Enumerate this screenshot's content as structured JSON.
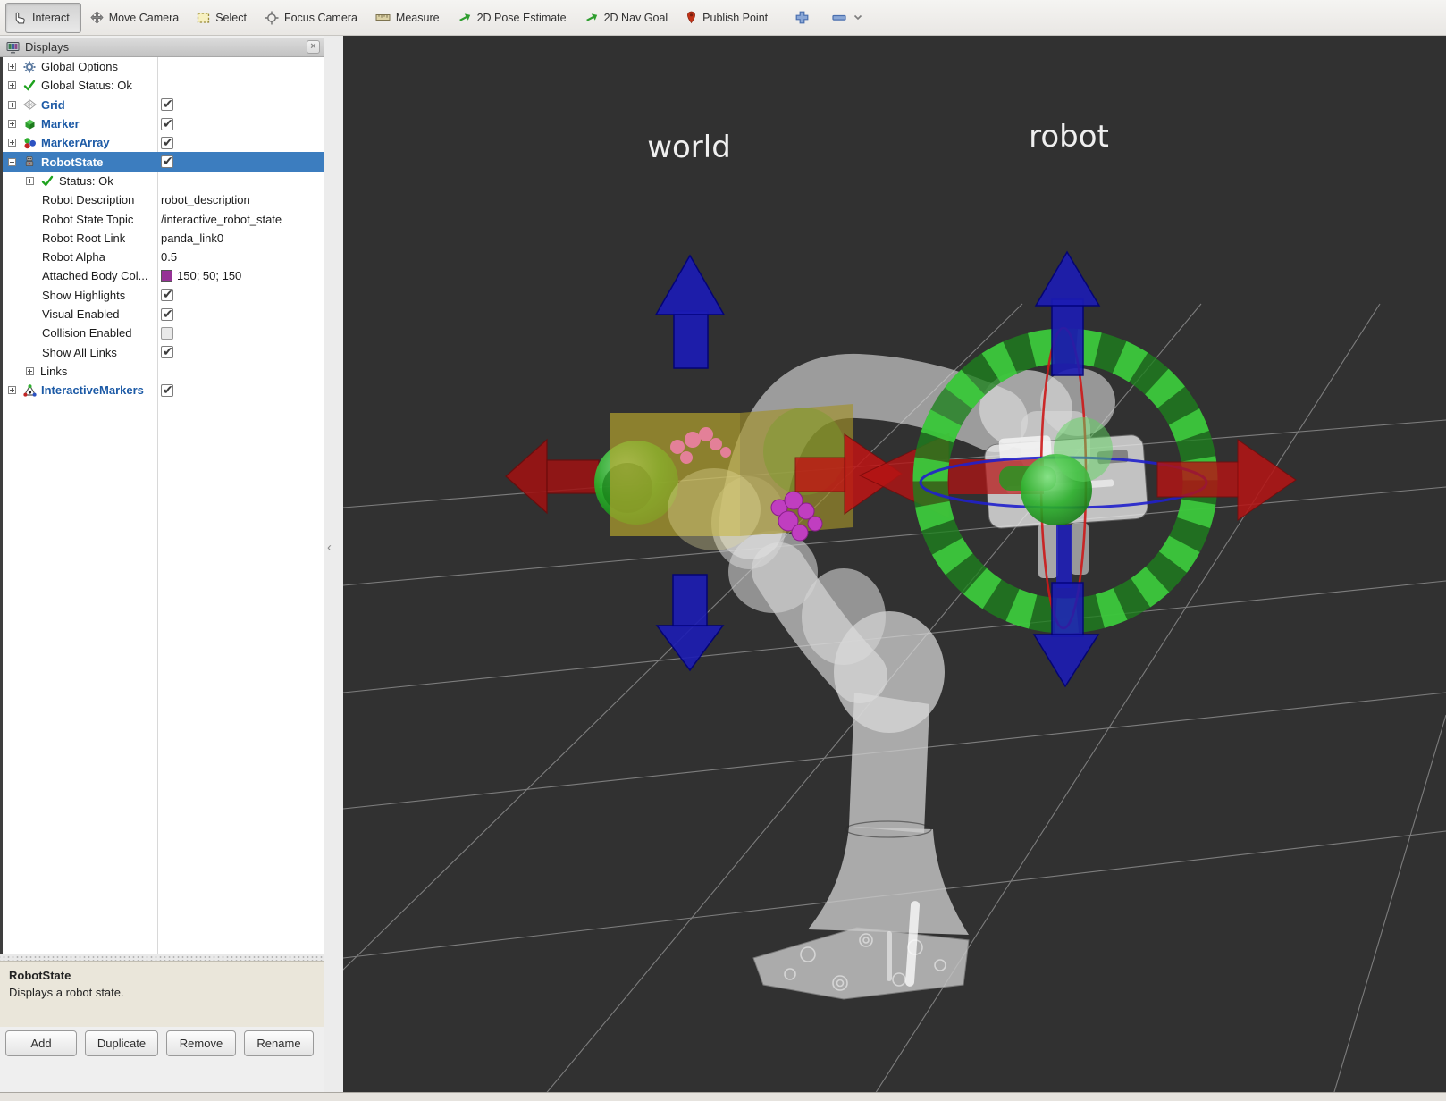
{
  "toolbar": {
    "tools": [
      {
        "label": "Interact",
        "icon": "hand-icon",
        "active": true
      },
      {
        "label": "Move Camera",
        "icon": "move-camera-icon",
        "active": false
      },
      {
        "label": "Select",
        "icon": "select-box-icon",
        "active": false
      },
      {
        "label": "Focus Camera",
        "icon": "focus-camera-icon",
        "active": false
      },
      {
        "label": "Measure",
        "icon": "measure-ruler-icon",
        "active": false
      },
      {
        "label": "2D Pose Estimate",
        "icon": "green-arrow-icon",
        "active": false
      },
      {
        "label": "2D Nav Goal",
        "icon": "green-arrow-icon",
        "active": false
      },
      {
        "label": "Publish Point",
        "icon": "map-pin-icon",
        "active": false
      }
    ],
    "add_tool_icon": "plus-icon",
    "remove_tool_icon": "minus-icon"
  },
  "displays_panel": {
    "title": "Displays",
    "close_icon": "×",
    "rows": [
      {
        "label": "Global Options",
        "icon": "gear-icon",
        "expander": "plus"
      },
      {
        "label": "Global Status: Ok",
        "icon": "check-icon",
        "expander": "plus"
      },
      {
        "label": "Grid",
        "icon": "grid-icon",
        "expander": "plus",
        "checkbox": "checked",
        "bold": true
      },
      {
        "label": "Marker",
        "icon": "marker-cube-icon",
        "expander": "plus",
        "checkbox": "checked",
        "bold": true
      },
      {
        "label": "MarkerArray",
        "icon": "marker-array-icon",
        "expander": "plus",
        "checkbox": "checked",
        "bold": true
      },
      {
        "label": "RobotState",
        "icon": "robot-icon",
        "expander": "minus",
        "checkbox": "checked",
        "bold": true,
        "selected": true
      },
      {
        "label": "Status: Ok",
        "icon": "check-icon",
        "expander": "plus",
        "indent": 1
      },
      {
        "label": "Robot Description",
        "value": "robot_description",
        "indent": 1
      },
      {
        "label": "Robot State Topic",
        "value": "/interactive_robot_state",
        "indent": 1
      },
      {
        "label": "Robot Root Link",
        "value": "panda_link0",
        "indent": 1
      },
      {
        "label": "Robot Alpha",
        "value": "0.5",
        "indent": 1
      },
      {
        "label": "Attached Body Col...",
        "value": "150; 50; 150",
        "swatch": "#963296",
        "indent": 1
      },
      {
        "label": "Show Highlights",
        "checkbox": "checked",
        "indent": 1
      },
      {
        "label": "Visual Enabled",
        "checkbox": "checked",
        "indent": 1
      },
      {
        "label": "Collision Enabled",
        "checkbox": "unchecked",
        "indent": 1
      },
      {
        "label": "Show All Links",
        "checkbox": "checked",
        "indent": 1
      },
      {
        "label": "Links",
        "expander": "plus",
        "indent": 1
      },
      {
        "label": "InteractiveMarkers",
        "icon": "interactive-markers-icon",
        "expander": "plus",
        "checkbox": "checked",
        "bold": true
      }
    ],
    "description": {
      "title": "RobotState",
      "text": "Displays a robot state."
    },
    "buttons": [
      "Add",
      "Duplicate",
      "Remove",
      "Rename"
    ]
  },
  "viewport": {
    "frame_labels": [
      {
        "text": "world"
      },
      {
        "text": "robot"
      }
    ],
    "colors": {
      "background": "#313131",
      "grid_line": "#c8c8c8",
      "attached_cube_yellow": "#b8a62e",
      "arrow_red": "#b51414",
      "arrow_blue": "#1c1cb4",
      "ring_green_light": "#3fd03f",
      "ring_green_dark": "#1d821d",
      "sphere_green": "#2ab02a",
      "contact_pink": "#e8809e",
      "contact_magenta": "#c03ec0",
      "robot_gray": "#d8d8d8",
      "attached_body_purple": "#963296"
    }
  }
}
